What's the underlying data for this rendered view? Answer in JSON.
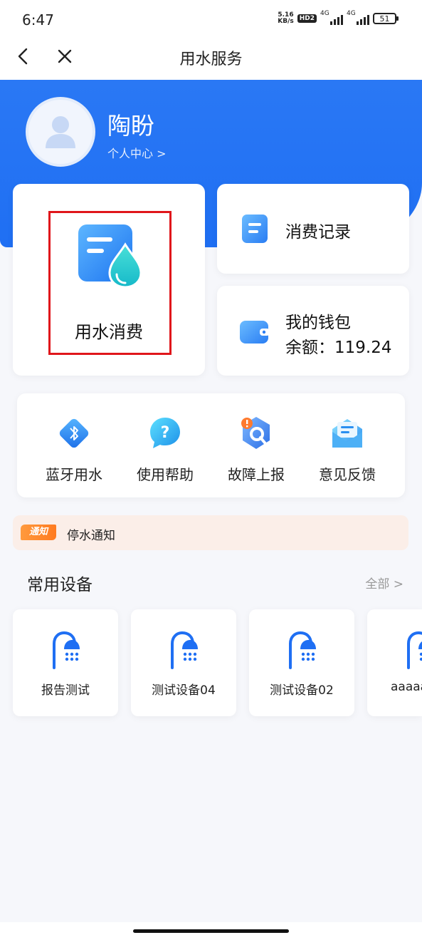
{
  "status_bar": {
    "time": "6:47",
    "net_speed_value": "5.16",
    "net_speed_unit": "KB/s",
    "hd_badge": "HD2",
    "signal_1_label": "4G",
    "signal_2_label": "4G",
    "battery_level": "51"
  },
  "nav": {
    "title": "用水服务",
    "back_icon": "chevron-left-icon",
    "close_icon": "close-icon"
  },
  "profile": {
    "name": "陶盼",
    "center_link": "个人中心 >"
  },
  "cards": {
    "water_consumption": "用水消费",
    "consumption_record": "消费记录",
    "wallet_title": "我的钱包",
    "wallet_balance": "余额：119.24"
  },
  "quick_actions": [
    {
      "label": "蓝牙用水",
      "icon": "bluetooth-icon"
    },
    {
      "label": "使用帮助",
      "icon": "help-icon"
    },
    {
      "label": "故障上报",
      "icon": "fault-report-icon"
    },
    {
      "label": "意见反馈",
      "icon": "feedback-icon"
    }
  ],
  "notice": {
    "badge": "通知",
    "text": "停水通知"
  },
  "devices_section": {
    "title": "常用设备",
    "all_link": "全部 >",
    "items": [
      {
        "label": "报告测试",
        "icon": "shower-icon"
      },
      {
        "label": "测试设备04",
        "icon": "shower-icon"
      },
      {
        "label": "测试设备02",
        "icon": "shower-icon"
      },
      {
        "label": "aaaaa",
        "icon": "shower-icon"
      }
    ]
  },
  "colors": {
    "brand_blue": "#1f6ff3",
    "highlight_red": "#e0161b",
    "notice_bg": "#fbeee8",
    "notice_badge": "#ff8a2b"
  }
}
